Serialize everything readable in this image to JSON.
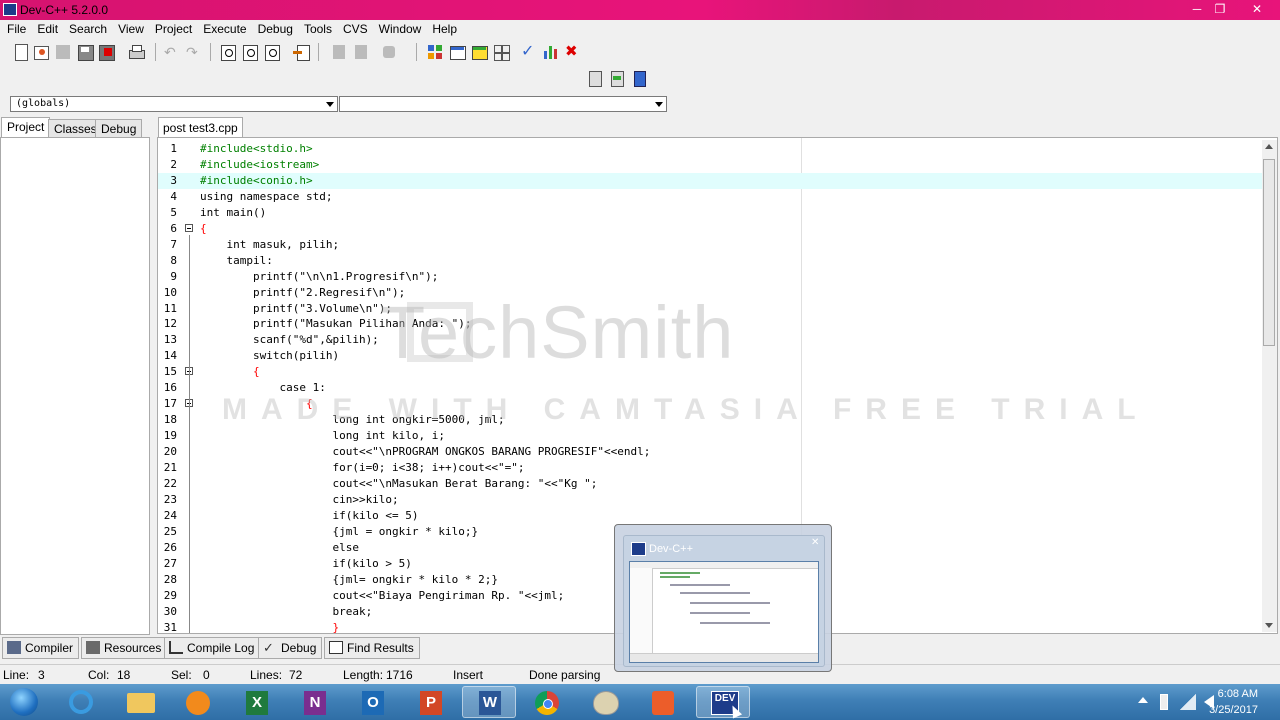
{
  "window": {
    "title": "Dev-C++ 5.2.0.0"
  },
  "menu": [
    "File",
    "Edit",
    "Search",
    "View",
    "Project",
    "Execute",
    "Debug",
    "Tools",
    "CVS",
    "Window",
    "Help"
  ],
  "combos": {
    "scope": "(globals)",
    "member": ""
  },
  "left_tabs": [
    "Project",
    "Classes",
    "Debug"
  ],
  "editor": {
    "tab": "post test3.cpp",
    "current_line": 3,
    "lines": [
      {
        "n": "1",
        "text": "#include<stdio.h>",
        "color": "#008000"
      },
      {
        "n": "2",
        "text": "#include<iostream>",
        "color": "#008000"
      },
      {
        "n": "3",
        "text": "#include<conio.h>",
        "color": "#008000"
      },
      {
        "n": "4",
        "text": "using namespace std;",
        "color": "#000000"
      },
      {
        "n": "5",
        "text": "int main()",
        "color": "#000000"
      },
      {
        "n": "6",
        "text": "{",
        "color": "#ff0000"
      },
      {
        "n": "7",
        "text": "    int masuk, pilih;",
        "color": "#000000"
      },
      {
        "n": "8",
        "text": "    tampil:",
        "color": "#000000"
      },
      {
        "n": "9",
        "text": "        printf(\"\\n\\n1.Progresif\\n\");",
        "color": "#000000"
      },
      {
        "n": "10",
        "text": "        printf(\"2.Regresif\\n\");",
        "color": "#000000"
      },
      {
        "n": "11",
        "text": "        printf(\"3.Volume\\n\");",
        "color": "#000000"
      },
      {
        "n": "12",
        "text": "        printf(\"Masukan Pilihan Anda: \");",
        "color": "#000000"
      },
      {
        "n": "13",
        "text": "        scanf(\"%d\",&pilih);",
        "color": "#000000"
      },
      {
        "n": "14",
        "text": "        switch(pilih)",
        "color": "#000000"
      },
      {
        "n": "15",
        "text": "        {",
        "color": "#ff0000"
      },
      {
        "n": "16",
        "text": "            case 1:",
        "color": "#000000"
      },
      {
        "n": "17",
        "text": "                {",
        "color": "#ff0000"
      },
      {
        "n": "18",
        "text": "                    long int ongkir=5000, jml;",
        "color": "#000000"
      },
      {
        "n": "19",
        "text": "                    long int kilo, i;",
        "color": "#000000"
      },
      {
        "n": "20",
        "text": "                    cout<<\"\\nPROGRAM ONGKOS BARANG PROGRESIF\"<<endl;",
        "color": "#000000"
      },
      {
        "n": "21",
        "text": "                    for(i=0; i<38; i++)cout<<\"=\";",
        "color": "#000000"
      },
      {
        "n": "22",
        "text": "                    cout<<\"\\nMasukan Berat Barang: \"<<\"Kg \";",
        "color": "#000000"
      },
      {
        "n": "23",
        "text": "                    cin>>kilo;",
        "color": "#000000"
      },
      {
        "n": "24",
        "text": "                    if(kilo <= 5)",
        "color": "#000000"
      },
      {
        "n": "25",
        "text": "                    {jml = ongkir * kilo;}",
        "color": "#000000"
      },
      {
        "n": "26",
        "text": "                    else",
        "color": "#000000"
      },
      {
        "n": "27",
        "text": "                    if(kilo > 5)",
        "color": "#000000"
      },
      {
        "n": "28",
        "text": "                    {jml= ongkir * kilo * 2;}",
        "color": "#000000"
      },
      {
        "n": "29",
        "text": "                    cout<<\"Biaya Pengiriman Rp. \"<<jml;",
        "color": "#000000"
      },
      {
        "n": "30",
        "text": "                    break;",
        "color": "#000000"
      },
      {
        "n": "31",
        "text": "                    }",
        "color": "#ff0000"
      }
    ]
  },
  "watermark": {
    "brand": "TechSmith",
    "note": "MADE WITH CAMTASIA FREE TRIAL"
  },
  "bottom_tabs": [
    "Compiler",
    "Resources",
    "Compile Log",
    "Debug",
    "Find Results"
  ],
  "status": {
    "line_label": "Line:",
    "line": "3",
    "col_label": "Col:",
    "col": "18",
    "sel_label": "Sel:",
    "sel": "0",
    "lines_label": "Lines:",
    "lines": "72",
    "length_label": "Length:",
    "length": "1716",
    "mode": "Insert",
    "message": "Done parsing"
  },
  "popup": {
    "title": "Dev-C++"
  },
  "clock": {
    "time": "6:08 AM",
    "date": "3/25/2017"
  },
  "taskbar_apps": [
    "start-orb-icon",
    "internet-explorer-icon",
    "file-explorer-icon",
    "media-player-icon",
    "excel-icon",
    "onenote-icon",
    "outlook-icon",
    "powerpoint-icon",
    "word-icon",
    "chrome-icon",
    "paint-icon",
    "camtasia-icon",
    "devcpp-icon"
  ],
  "colors": {
    "titlebar": "#e8147a",
    "taskbar": "#3f7fb6",
    "current_line": "#e0fdfd"
  }
}
